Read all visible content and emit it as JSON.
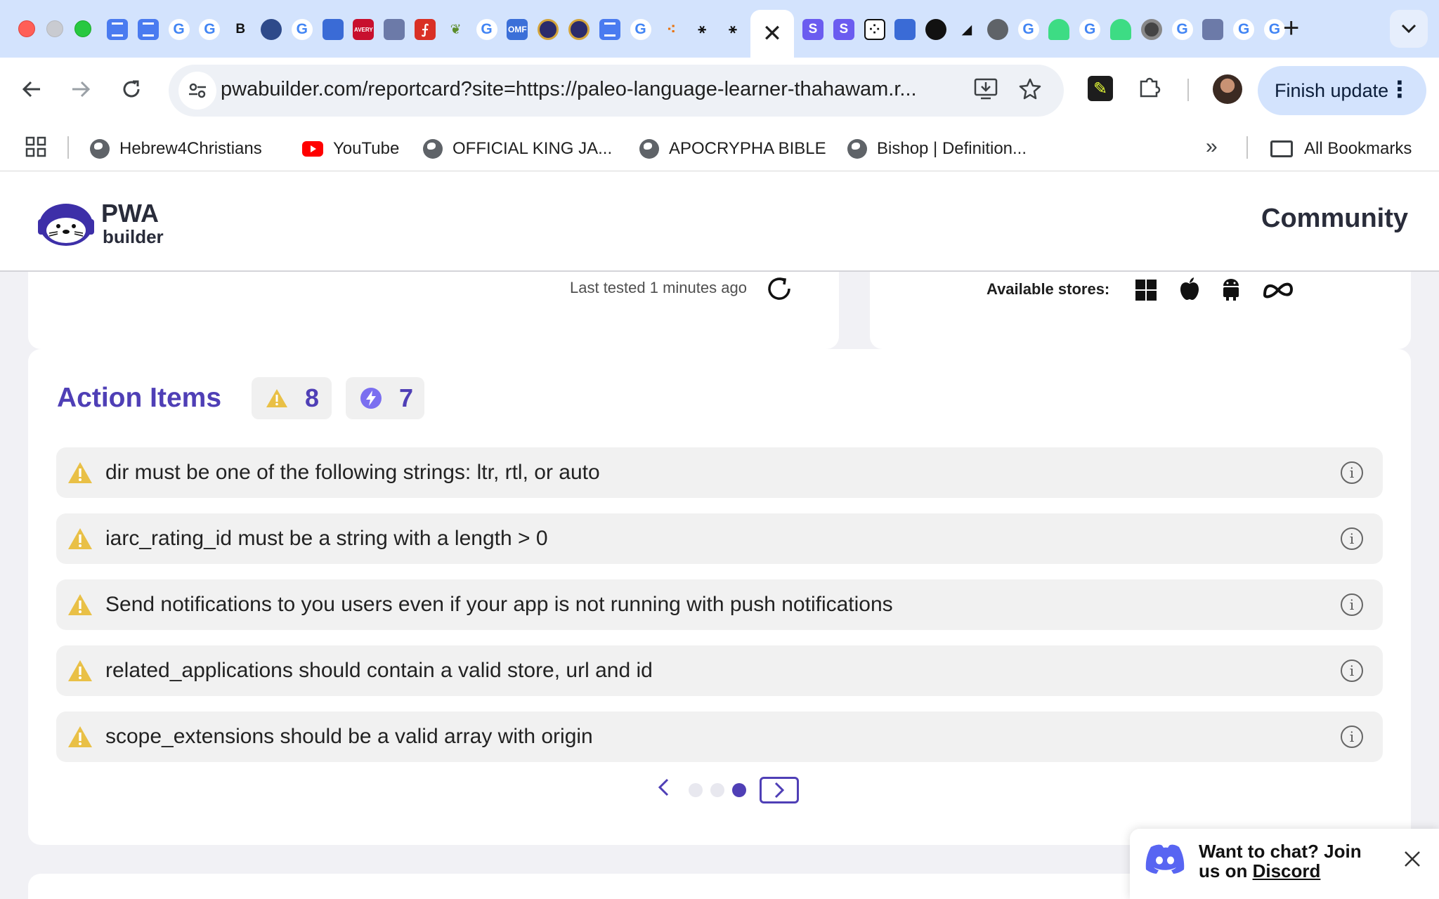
{
  "browser": {
    "tab_favicons": [
      "doc-icon",
      "doc-icon",
      "google-icon",
      "google-icon",
      "bold-b-icon",
      "seal-icon",
      "google-icon",
      "mail-icon",
      "avery-icon",
      "chart-icon",
      "pdf-icon",
      "lizard-icon",
      "google-icon",
      "omf-icon",
      "badge-icon",
      "badge-icon",
      "doc-icon",
      "google-icon",
      "dots-icon",
      "xp-icon",
      "xp-icon"
    ],
    "active_tab_close": "✕",
    "tab_favicons_right": [
      "s-icon",
      "s-icon",
      "dice-icon",
      "mail-icon",
      "github-icon",
      "puzzle-icon",
      "globe-icon",
      "google-icon",
      "android-icon",
      "google-icon",
      "android-icon",
      "chrome-icon",
      "google-icon",
      "chart-icon",
      "google-icon",
      "google-icon"
    ],
    "new_tab": "+",
    "tab_menu": "⌄",
    "url": "pwabuilder.com/reportcard?site=https://paleo-language-learner-thahawam.r...",
    "finish_update": "Finish update",
    "bookmarks": [
      {
        "label": "Hebrew4Christians",
        "icon": "globe-icon"
      },
      {
        "label": "YouTube",
        "icon": "youtube-icon"
      },
      {
        "label": "OFFICIAL KING JA...",
        "icon": "globe-icon"
      },
      {
        "label": "APOCRYPHA BIBLE",
        "icon": "globe-icon"
      },
      {
        "label": "Bishop | Definition...",
        "icon": "globe-icon"
      }
    ],
    "all_bookmarks": "All Bookmarks"
  },
  "site": {
    "logo_line1": "PWA",
    "logo_line2": "builder",
    "nav_community": "Community"
  },
  "test_card": {
    "last_tested": "Last tested 1 minutes ago"
  },
  "stores_card": {
    "label": "Available stores:",
    "stores": [
      "windows-icon",
      "apple-icon",
      "android-icon",
      "meta-icon"
    ]
  },
  "action_items": {
    "title": "Action Items",
    "warning_count": "8",
    "enhancement_count": "7",
    "items": [
      "dir must be one of the following strings: ltr, rtl, or auto",
      "iarc_rating_id must be a string with a length > 0",
      "Send notifications to you users even if your app is not running with push notifications",
      "related_applications should contain a valid store, url and id",
      "scope_extensions should be a valid array with origin"
    ],
    "pager": {
      "pages": 3,
      "current": 3
    }
  },
  "discord": {
    "line1": "Want to chat? Join",
    "line2_prefix": "us on ",
    "link": "Discord"
  },
  "colors": {
    "accent": "#4f3fb6",
    "warning": "#e9c046",
    "enhancement": "#7b6ff0",
    "tabstrip": "#d3e3fd"
  }
}
